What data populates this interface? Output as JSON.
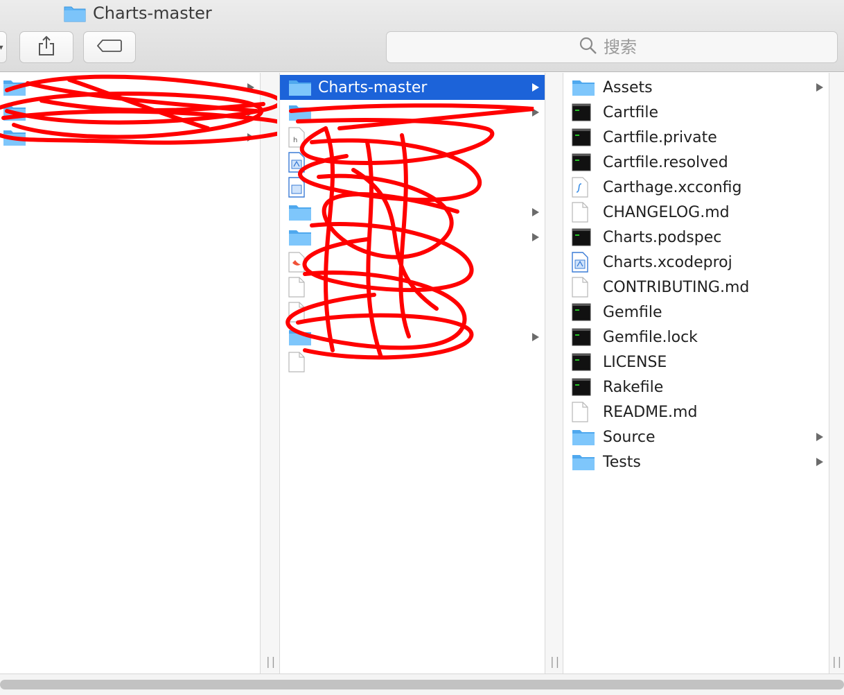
{
  "window": {
    "title": "Charts-master"
  },
  "toolbar": {
    "search_placeholder": "搜索"
  },
  "colors": {
    "selection": "#1c63d9",
    "folder": "#5fb4f5",
    "redaction": "#ff0000"
  },
  "columns": {
    "col1": {
      "items": [
        {
          "label": "",
          "icon": "folder-icon",
          "has_children": true,
          "redacted": true
        },
        {
          "label": "",
          "icon": "folder-icon",
          "has_children": true,
          "redacted": true
        },
        {
          "label": "",
          "icon": "folder-icon",
          "has_children": true,
          "redacted": true
        }
      ]
    },
    "col2": {
      "items": [
        {
          "label": "Charts-master",
          "icon": "folder-icon",
          "has_children": true,
          "selected": true
        },
        {
          "label": "",
          "icon": "folder-icon",
          "has_children": true,
          "redacted": true
        },
        {
          "label": "",
          "icon": "header-file-icon",
          "has_children": false,
          "redacted": true
        },
        {
          "label": "",
          "icon": "xcode-project-icon",
          "has_children": false,
          "redacted": true
        },
        {
          "label": "",
          "icon": "xcode-workspace-icon",
          "has_children": false,
          "redacted": true
        },
        {
          "label": "",
          "icon": "folder-icon",
          "has_children": true,
          "redacted": true
        },
        {
          "label": "",
          "icon": "folder-icon",
          "has_children": true,
          "redacted": true
        },
        {
          "label": "",
          "icon": "swift-file-icon",
          "has_children": false,
          "redacted": true
        },
        {
          "label": "",
          "icon": "document-icon",
          "has_children": false,
          "redacted": true
        },
        {
          "label": "",
          "icon": "document-icon",
          "has_children": false,
          "redacted": true
        },
        {
          "label": "",
          "icon": "folder-icon",
          "has_children": true,
          "redacted": true
        },
        {
          "label": "",
          "icon": "document-icon",
          "has_children": false,
          "redacted": true
        }
      ]
    },
    "col3": {
      "items": [
        {
          "label": "Assets",
          "icon": "folder-icon",
          "has_children": true
        },
        {
          "label": "Cartfile",
          "icon": "terminal-file-icon",
          "has_children": false
        },
        {
          "label": "Cartfile.private",
          "icon": "terminal-file-icon",
          "has_children": false
        },
        {
          "label": "Cartfile.resolved",
          "icon": "terminal-file-icon",
          "has_children": false
        },
        {
          "label": "Carthage.xcconfig",
          "icon": "xcconfig-file-icon",
          "has_children": false
        },
        {
          "label": "CHANGELOG.md",
          "icon": "document-icon",
          "has_children": false
        },
        {
          "label": "Charts.podspec",
          "icon": "terminal-file-icon",
          "has_children": false
        },
        {
          "label": "Charts.xcodeproj",
          "icon": "xcode-project-icon",
          "has_children": false
        },
        {
          "label": "CONTRIBUTING.md",
          "icon": "document-icon",
          "has_children": false
        },
        {
          "label": "Gemfile",
          "icon": "terminal-file-icon",
          "has_children": false
        },
        {
          "label": "Gemfile.lock",
          "icon": "terminal-file-icon",
          "has_children": false
        },
        {
          "label": "LICENSE",
          "icon": "terminal-file-icon",
          "has_children": false
        },
        {
          "label": "Rakefile",
          "icon": "terminal-file-icon",
          "has_children": false
        },
        {
          "label": "README.md",
          "icon": "document-icon",
          "has_children": false
        },
        {
          "label": "Source",
          "icon": "folder-icon",
          "has_children": true
        },
        {
          "label": "Tests",
          "icon": "folder-icon",
          "has_children": true
        }
      ]
    }
  }
}
